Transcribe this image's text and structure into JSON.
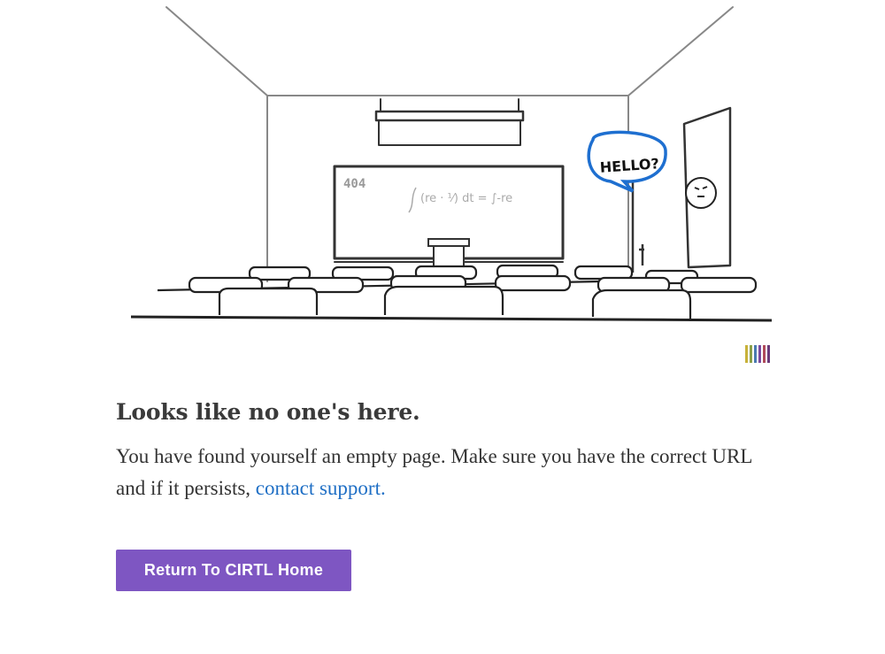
{
  "illustration": {
    "board_label": "404",
    "bubble_text": "HELLO?"
  },
  "message": {
    "headline": "Looks like no one's here.",
    "body_prefix": "You have found yourself an empty page. Make sure you have the correct URL and if it persists, ",
    "link_text": "contact support."
  },
  "actions": {
    "home_button_label": "Return To CIRTL Home"
  },
  "colors": {
    "button_bg": "#7e56c2",
    "link": "#1f6fc5",
    "bubble_outline": "#1e6fd0"
  }
}
